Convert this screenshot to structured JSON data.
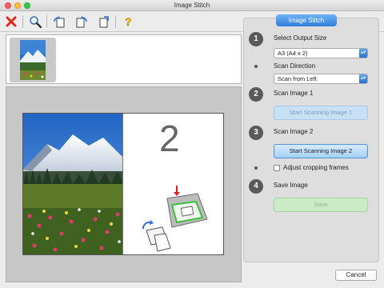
{
  "window": {
    "title": "Image Stitch"
  },
  "toolbar": {
    "icons": [
      "close-icon",
      "zoom-icon",
      "rotate-left-icon",
      "rotate-right-icon",
      "flip-icon",
      "help-icon"
    ]
  },
  "preview": {
    "page_number": "2"
  },
  "panel": {
    "title": "Image Stitch",
    "steps": [
      {
        "number": "1",
        "label": "Select Output Size"
      },
      {
        "number": "2",
        "label": "Scan Image 1"
      },
      {
        "number": "3",
        "label": "Scan Image 2"
      },
      {
        "number": "4",
        "label": "Save Image"
      }
    ],
    "output_size": {
      "value": "A3 (A4 x 2)"
    },
    "scan_direction": {
      "label": "Scan Direction",
      "value": "Scan from Left"
    },
    "scan1_button": "Start Scanning Image 1",
    "scan2_button": "Start Scanning Image 2",
    "adjust_checkbox": {
      "label": "Adjust cropping frames",
      "checked": false
    },
    "save_button": "Save"
  },
  "footer": {
    "cancel_label": "Cancel"
  },
  "colors": {
    "accent": "#2f7fdb",
    "close_red": "#e0281e",
    "save_green": "#c9ecc7"
  }
}
